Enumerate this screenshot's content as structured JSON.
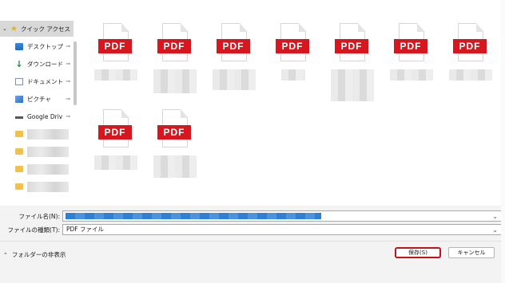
{
  "sidebar": {
    "quick_access": "クイック アクセス",
    "items": [
      {
        "label": "デスクトップ",
        "icon": "desktop-icon",
        "pinned": true
      },
      {
        "label": "ダウンロード",
        "icon": "download-icon",
        "pinned": true
      },
      {
        "label": "ドキュメント",
        "icon": "documents-icon",
        "pinned": true
      },
      {
        "label": "ピクチャ",
        "icon": "pictures-icon",
        "pinned": true
      },
      {
        "label": "Google Drive",
        "icon": "drive-icon",
        "pinned": true
      }
    ],
    "pin_glyph": "📌"
  },
  "files": {
    "icon_text": "PDF",
    "count": 9
  },
  "form": {
    "filename_label": "ファイル名(N):",
    "filetype_label": "ファイルの種類(T):",
    "filetype_value": "PDF ファイル"
  },
  "footer": {
    "hide_folders": "フォルダーの非表示",
    "save": "保存(S)",
    "cancel": "キャンセル"
  },
  "colors": {
    "pdf_red": "#d6171f",
    "highlight_border": "#c4121a",
    "selection_blue": "#2f7fd6"
  }
}
